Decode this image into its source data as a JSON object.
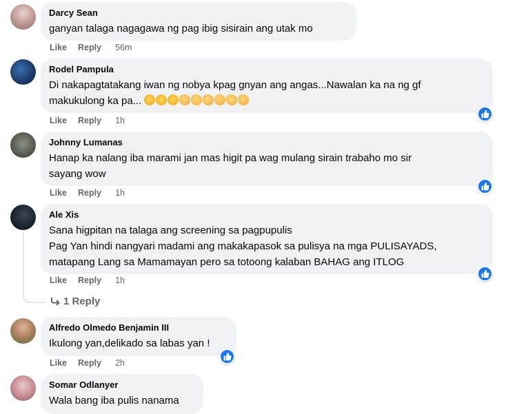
{
  "comments": [
    {
      "author": "Darcy Sean",
      "lines": [
        "ganyan talaga nagagawa ng pag ibig sisirain ang utak mo"
      ],
      "like": "Like",
      "reply": "Reply",
      "time": "56m"
    },
    {
      "author": "Rodel Pampula",
      "lines": [
        "Di nakapagtatakang iwan ng nobya kpag gnyan ang angas...Nawalan ka na ng gf",
        "makukulong ka pa..."
      ],
      "like": "Like",
      "reply": "Reply",
      "time": "1h"
    },
    {
      "author": "Johnny Lumanas",
      "lines": [
        "Hanap ka nalang iba marami jan mas higit pa wag mulang sirain trabaho mo sir",
        "sayang wow"
      ],
      "like": "Like",
      "reply": "Reply",
      "time": "1h"
    },
    {
      "author": "Ale Xis",
      "lines": [
        "Sana higpitan na talaga ang screening sa pagpupulis",
        "Pag Yan hindi nangyari madami ang makakapasok sa pulisya na mga PULISAYADS,",
        "matapang Lang sa Mamamayan pero sa totoong kalaban BAHAG ang ITLOG"
      ],
      "like": "Like",
      "reply": "Reply",
      "time": "1h",
      "replies_link": "1 Reply"
    },
    {
      "author": "Alfredo Olmedo Benjamin III",
      "lines": [
        "Ikulong yan,delikado sa labas yan !"
      ],
      "like": "Like",
      "reply": "Reply",
      "time": "2h"
    },
    {
      "author": "Somar Odlanyer",
      "lines": [
        "Wala bang iba pulis nanama"
      ]
    }
  ],
  "colors": {
    "bubble": "#f0f2f5",
    "meta": "#65676b",
    "like_blue": "#1877f2"
  },
  "icons": {
    "reaction": "like-thumb-icon",
    "reply_arrow": "reply-arrow-icon",
    "laugh_emoji": "laughing-emoji",
    "clap_emoji": "clapping-emoji"
  }
}
